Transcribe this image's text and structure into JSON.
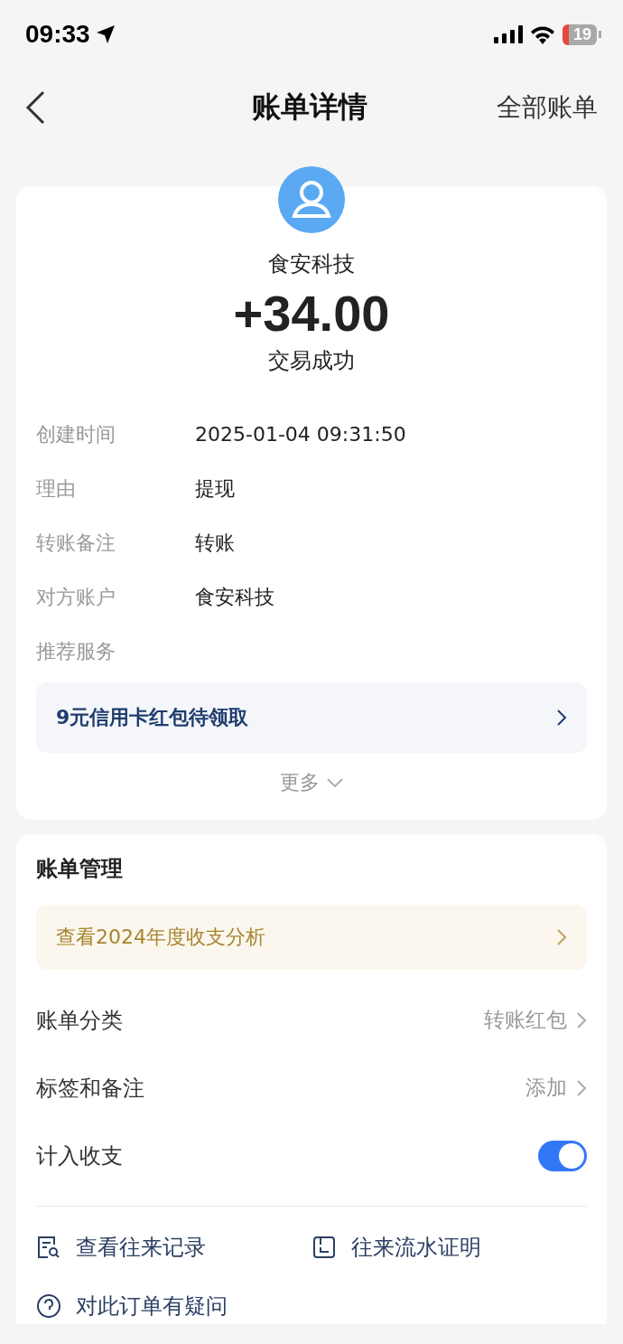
{
  "status_bar": {
    "time": "09:33",
    "battery": "19"
  },
  "nav": {
    "title": "账单详情",
    "right_action": "全部账单"
  },
  "summary": {
    "counterparty": "食安科技",
    "amount": "+34.00",
    "status": "交易成功"
  },
  "details": [
    {
      "label": "创建时间",
      "value": "2025-01-04 09:31:50"
    },
    {
      "label": "理由",
      "value": "提现"
    },
    {
      "label": "转账备注",
      "value": "转账"
    },
    {
      "label": "对方账户",
      "value": "食安科技"
    },
    {
      "label": "推荐服务"
    }
  ],
  "promo": {
    "text": "9元信用卡红包待领取"
  },
  "more": "更多",
  "management": {
    "title": "账单管理",
    "analysis_banner": "查看2024年度收支分析",
    "rows": [
      {
        "kind": "link",
        "label": "账单分类",
        "value": "转账红包"
      },
      {
        "kind": "link",
        "label": "标签和备注",
        "value": "添加"
      },
      {
        "kind": "toggle",
        "label": "计入收支",
        "on": true
      }
    ]
  },
  "actions": [
    {
      "kind": "records",
      "label": "查看往来记录"
    },
    {
      "kind": "proof",
      "label": "往来流水证明"
    }
  ],
  "question": "对此订单有疑问"
}
